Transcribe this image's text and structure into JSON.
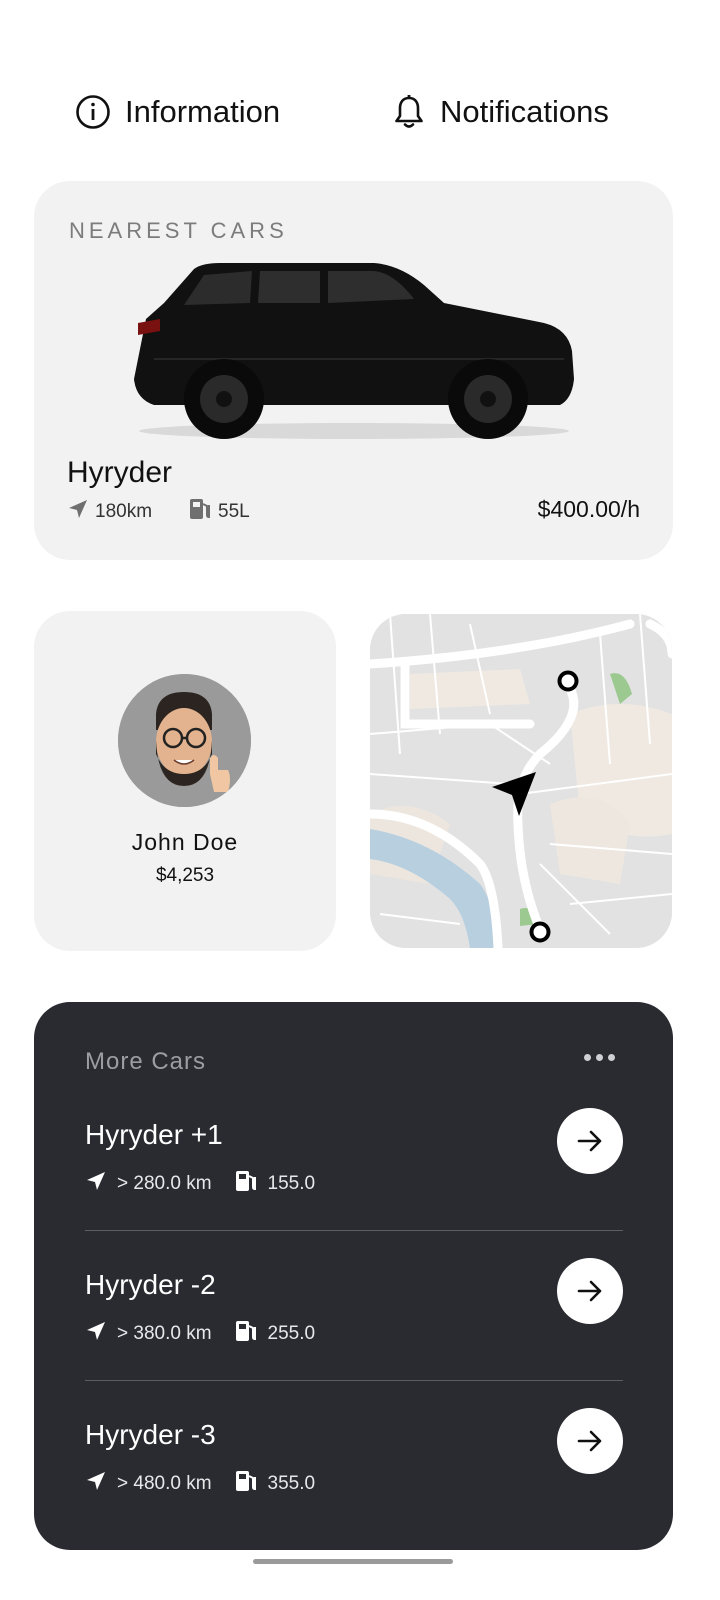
{
  "header": {
    "info_label": "Information",
    "notifications_label": "Notifications"
  },
  "nearest": {
    "section_label": "NEAREST CARS",
    "car_name": "Hyryder",
    "distance": "180km",
    "fuel": "55L",
    "price": "$400.00/h"
  },
  "profile": {
    "name": "John Doe",
    "balance": "$4,253"
  },
  "more_cars": {
    "title": "More Cars",
    "items": [
      {
        "name": "Hyryder +1",
        "distance": "> 280.0 km",
        "fuel": "155.0"
      },
      {
        "name": "Hyryder -2",
        "distance": "> 380.0 km",
        "fuel": "255.0"
      },
      {
        "name": "Hyryder -3",
        "distance": "> 480.0 km",
        "fuel": "355.0"
      }
    ]
  },
  "icons": {
    "info": "info-circle-icon",
    "notifications": "bell-icon",
    "distance": "navigation-arrow-icon",
    "fuel": "fuel-pump-icon",
    "more": "more-horizontal-icon",
    "go": "arrow-right-icon"
  },
  "colors": {
    "card_light": "#f2f2f2",
    "panel_dark": "#2a2b31",
    "muted_text": "#7c7c7c"
  }
}
